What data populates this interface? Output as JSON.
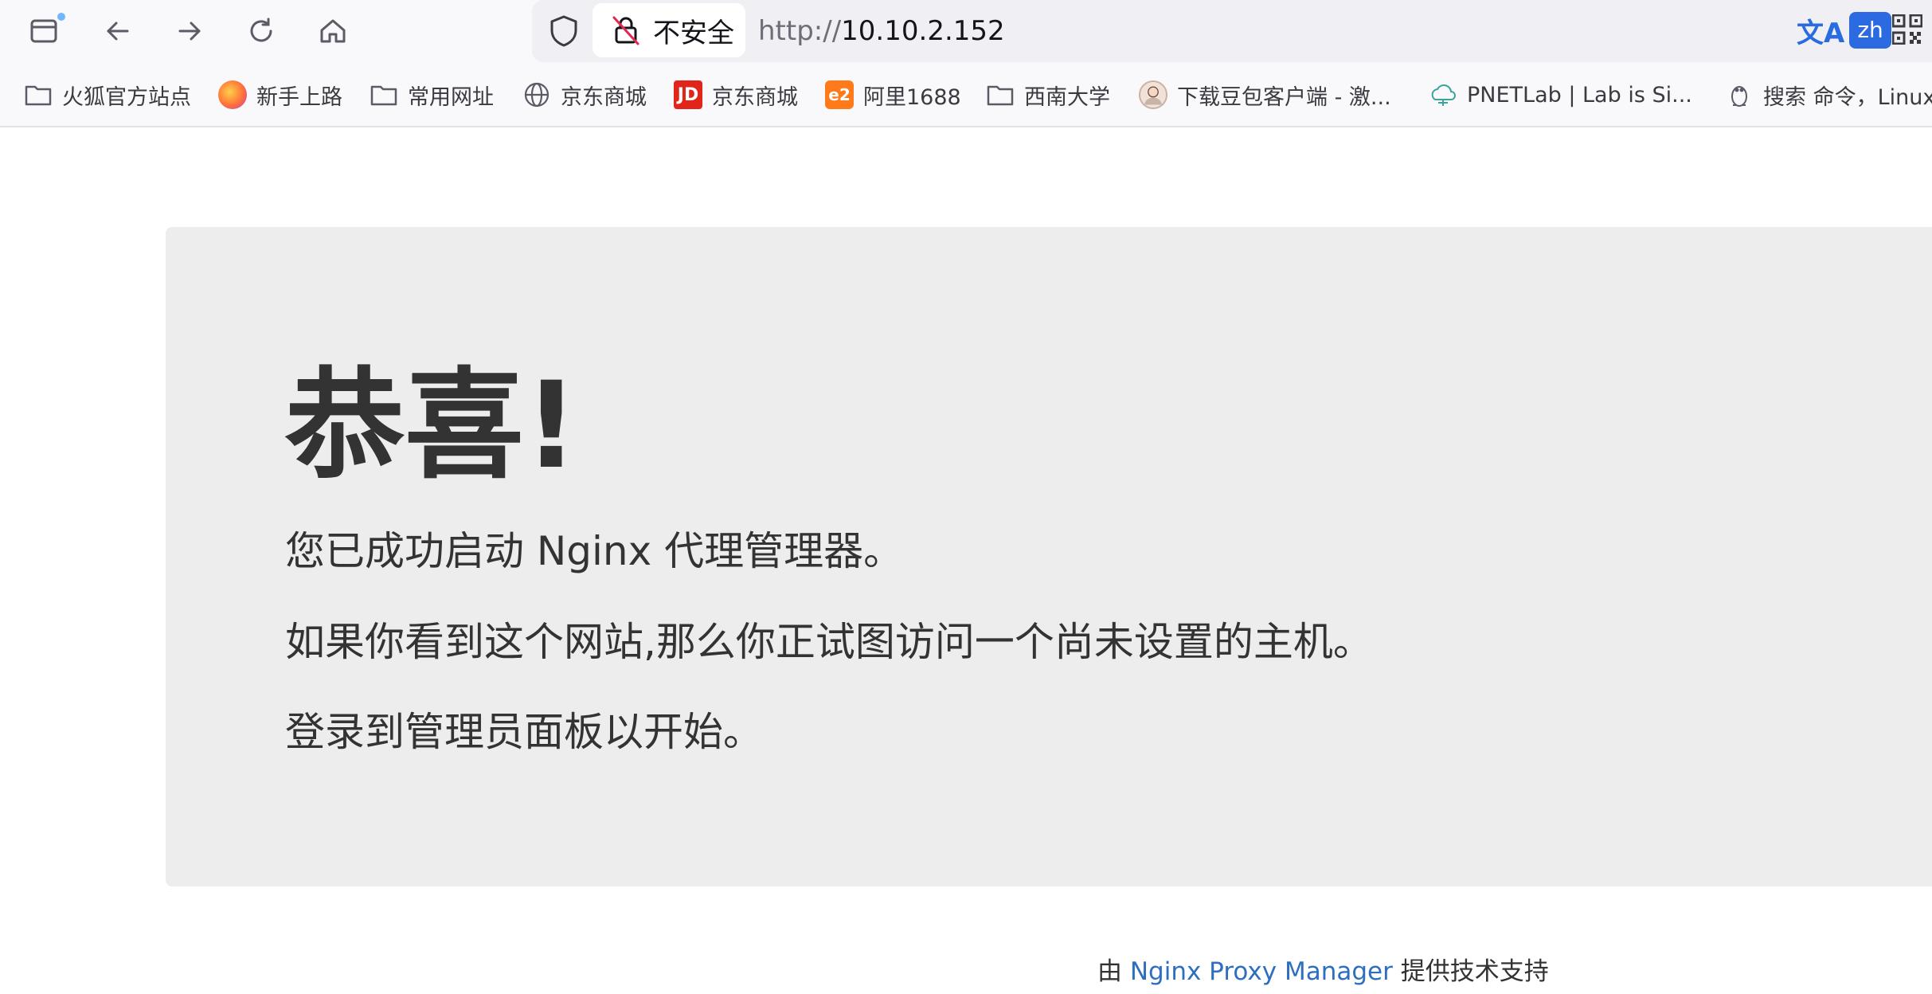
{
  "browser": {
    "url_scheme": "http://",
    "url_host": "10.10.2.152",
    "security_label": "不安全",
    "translate_glyph": "文A",
    "translate_lang": "zh"
  },
  "bookmarks": [
    {
      "label": "火狐官方站点",
      "icon": "folder-icon"
    },
    {
      "label": "新手上路",
      "icon": "firefox-icon"
    },
    {
      "label": "常用网址",
      "icon": "folder-icon"
    },
    {
      "label": "京东商城",
      "icon": "globe-icon"
    },
    {
      "label": "京东商城",
      "icon": "jd-icon",
      "glyph": "JD"
    },
    {
      "label": "阿里1688",
      "icon": "alibaba-icon",
      "glyph": "e2"
    },
    {
      "label": "西南大学",
      "icon": "folder-icon"
    },
    {
      "label": "下载豆包客户端 - 激...",
      "icon": "avatar-icon"
    },
    {
      "label": "PNETLab | Lab is Si...",
      "icon": "network-icon"
    },
    {
      "label": "搜索 命令，Linux",
      "icon": "penguin-icon"
    }
  ],
  "content": {
    "heading": "恭喜!",
    "line1": "您已成功启动 Nginx 代理管理器。",
    "line2": "如果你看到这个网站,那么你正试图访问一个尚未设置的主机。",
    "line3": "登录到管理员面板以开始。"
  },
  "footer": {
    "prefix": "由 ",
    "link": "Nginx Proxy Manager",
    "suffix": " 提供技术支持"
  },
  "colors": {
    "link": "#2d6fbe",
    "jumbotron": "#ededed",
    "text": "#333333"
  }
}
